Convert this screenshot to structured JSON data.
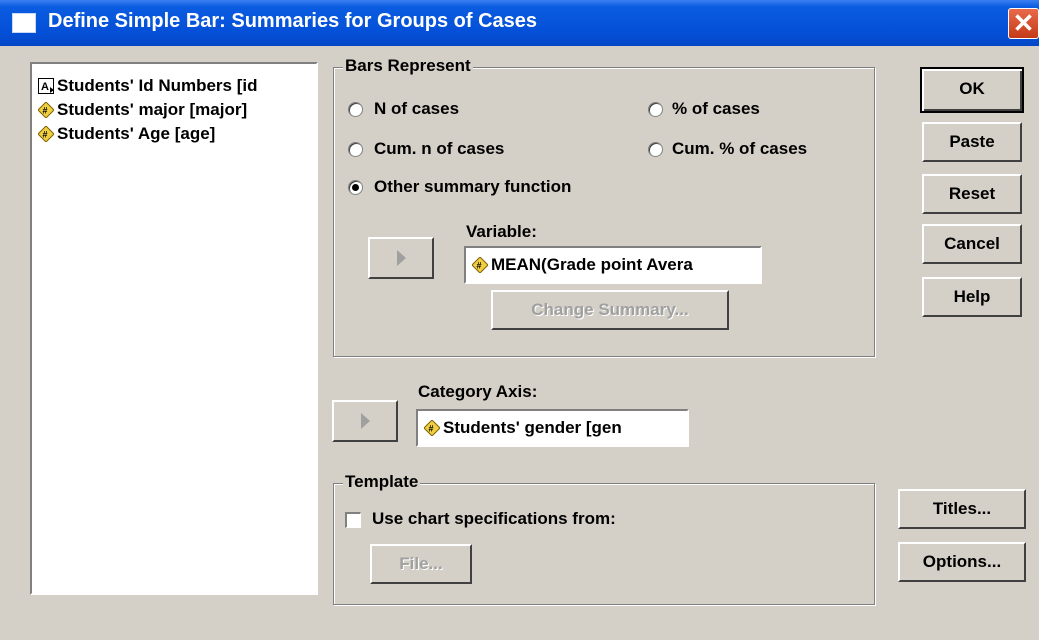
{
  "window": {
    "title": "Define Simple Bar: Summaries for Groups of Cases",
    "close_glyph": "✕"
  },
  "variable_list": [
    {
      "label": "Students' Id Numbers [id",
      "icon": "string-variable-icon"
    },
    {
      "label": "Students' major [major]",
      "icon": "numeric-variable-icon"
    },
    {
      "label": "Students' Age [age]",
      "icon": "numeric-variable-icon"
    }
  ],
  "bars_represent": {
    "legend": "Bars Represent",
    "options": {
      "n_cases": "N of cases",
      "pct_cases": "% of cases",
      "cum_n": "Cum. n of cases",
      "cum_pct": "Cum. % of cases",
      "other": "Other summary function"
    },
    "selected": "other",
    "variable_label": "Variable:",
    "variable_value": "MEAN(Grade point Avera",
    "change_summary": "Change Summary..."
  },
  "category_axis": {
    "label": "Category Axis:",
    "value": "Students' gender [gen"
  },
  "template": {
    "legend": "Template",
    "checkbox_label": "Use chart specifications from:",
    "checked": false,
    "file_button": "File..."
  },
  "buttons": {
    "ok": "OK",
    "paste": "Paste",
    "reset": "Reset",
    "cancel": "Cancel",
    "help": "Help",
    "titles": "Titles...",
    "options": "Options..."
  },
  "colors": {
    "title_bar": "#0450d8",
    "dialog_bg": "#d4d0c8",
    "close_button": "#d8502e"
  }
}
